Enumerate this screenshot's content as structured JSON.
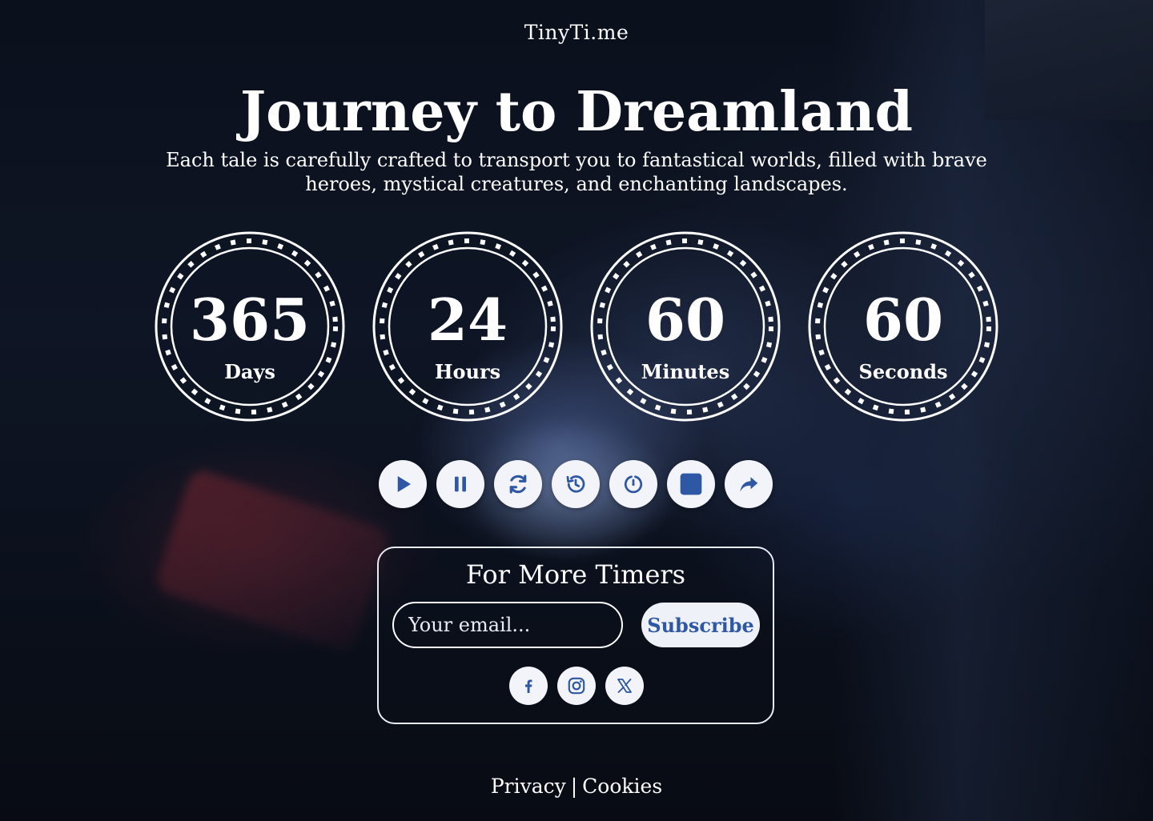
{
  "brand": "TinyTi.me",
  "hero": {
    "title": "Journey to Dreamland",
    "subtitle": "Each tale is carefully crafted to transport you to fantastical worlds, filled with brave heroes, mystical creatures, and enchanting landscapes."
  },
  "timers": [
    {
      "value": "365",
      "label": "Days"
    },
    {
      "value": "24",
      "label": "Hours"
    },
    {
      "value": "60",
      "label": "Minutes"
    },
    {
      "value": "60",
      "label": "Seconds"
    }
  ],
  "controls": [
    {
      "icon": "play-icon"
    },
    {
      "icon": "pause-icon"
    },
    {
      "icon": "refresh-icon"
    },
    {
      "icon": "history-icon"
    },
    {
      "icon": "timer-reset-icon"
    },
    {
      "icon": "stop-icon"
    },
    {
      "icon": "share-icon"
    }
  ],
  "newsletter": {
    "title": "For More Timers",
    "email_placeholder": "Your email...",
    "subscribe_label": "Subscribe"
  },
  "socials": [
    {
      "icon": "facebook-icon"
    },
    {
      "icon": "instagram-icon"
    },
    {
      "icon": "x-icon"
    }
  ],
  "footer": {
    "privacy": "Privacy",
    "separator": "|",
    "cookies": "Cookies"
  },
  "colors": {
    "accent": "#2e57a4",
    "button_bg": "#f2f4f9",
    "text": "#ffffff"
  }
}
